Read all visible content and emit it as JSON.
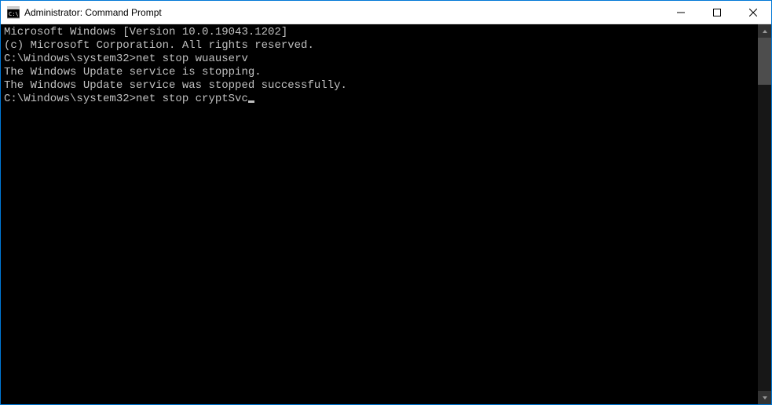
{
  "window": {
    "title": "Administrator: Command Prompt"
  },
  "terminal": {
    "lines": [
      "Microsoft Windows [Version 10.0.19043.1202]",
      "(c) Microsoft Corporation. All rights reserved.",
      "",
      "C:\\Windows\\system32>net stop wuauserv",
      "The Windows Update service is stopping.",
      "The Windows Update service was stopped successfully.",
      "",
      "",
      "C:\\Windows\\system32>net stop cryptSvc"
    ]
  }
}
